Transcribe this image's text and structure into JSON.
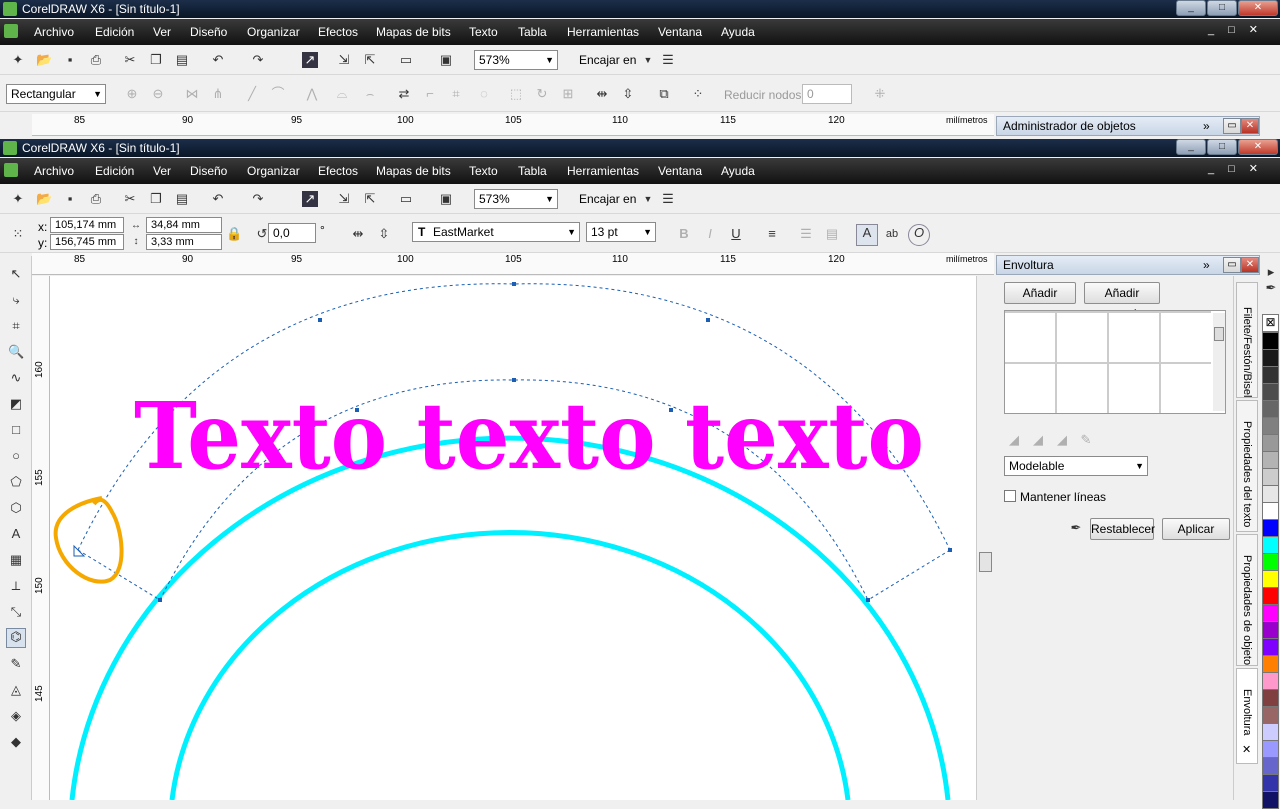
{
  "app": {
    "title": "CorelDRAW X6 - [Sin título-1]"
  },
  "menu": [
    "Archivo",
    "Edición",
    "Ver",
    "Diseño",
    "Organizar",
    "Efectos",
    "Mapas de bits",
    "Texto",
    "Tabla",
    "Herramientas",
    "Ventana",
    "Ayuda"
  ],
  "std": {
    "zoom": "573%",
    "snap": "Encajar en"
  },
  "nodes": {
    "mode": "Rectangular",
    "reduce_label": "Reducir nodos",
    "reduce_value": "0"
  },
  "props": {
    "x": "x:",
    "y": "y:",
    "x_val": "105,174 mm",
    "y_val": "156,745 mm",
    "w_val": "34,84 mm",
    "h_val": "3,33 mm",
    "angle": "0,0",
    "deg": "°",
    "font": "EastMarket",
    "size": "13 pt"
  },
  "ruler": {
    "unit": "milímetros",
    "ticks": [
      "85",
      "90",
      "95",
      "100",
      "105",
      "110",
      "115",
      "120"
    ],
    "vticks": [
      "160",
      "155",
      "150",
      "145"
    ]
  },
  "canvas": {
    "text": "Texto texto texto",
    "colors": {
      "text": "#ff00ff",
      "arcs": "#00f0ff",
      "annotation": "#f5a800",
      "path": "#1a5fb4"
    }
  },
  "docker_top": {
    "title": "Administrador de objetos"
  },
  "docker": {
    "title": "Envoltura",
    "add_new": "Añadir nueva",
    "add_preset": "Añadir preest.",
    "mode": "Modelable",
    "keep_lines": "Mantener líneas",
    "reset": "Restablecer",
    "apply": "Aplicar"
  },
  "tabs": [
    "Filete/Festón/Bisel",
    "Propiedades del texto",
    "Propiedades de objeto",
    "Envoltura"
  ],
  "palette": [
    "#000000",
    "#1a1a1a",
    "#333333",
    "#4d4d4d",
    "#666666",
    "#808080",
    "#999999",
    "#b3b3b3",
    "#cccccc",
    "#e6e6e6",
    "#ffffff",
    "#0000ff",
    "#00ffff",
    "#00ff00",
    "#ffff00",
    "#ff0000",
    "#ff00ff",
    "#9900cc",
    "#8000ff",
    "#ff8000",
    "#ff99cc",
    "#804040",
    "#996666",
    "#ccccff",
    "#9999ff",
    "#6666cc",
    "#3333aa",
    "#111166"
  ]
}
